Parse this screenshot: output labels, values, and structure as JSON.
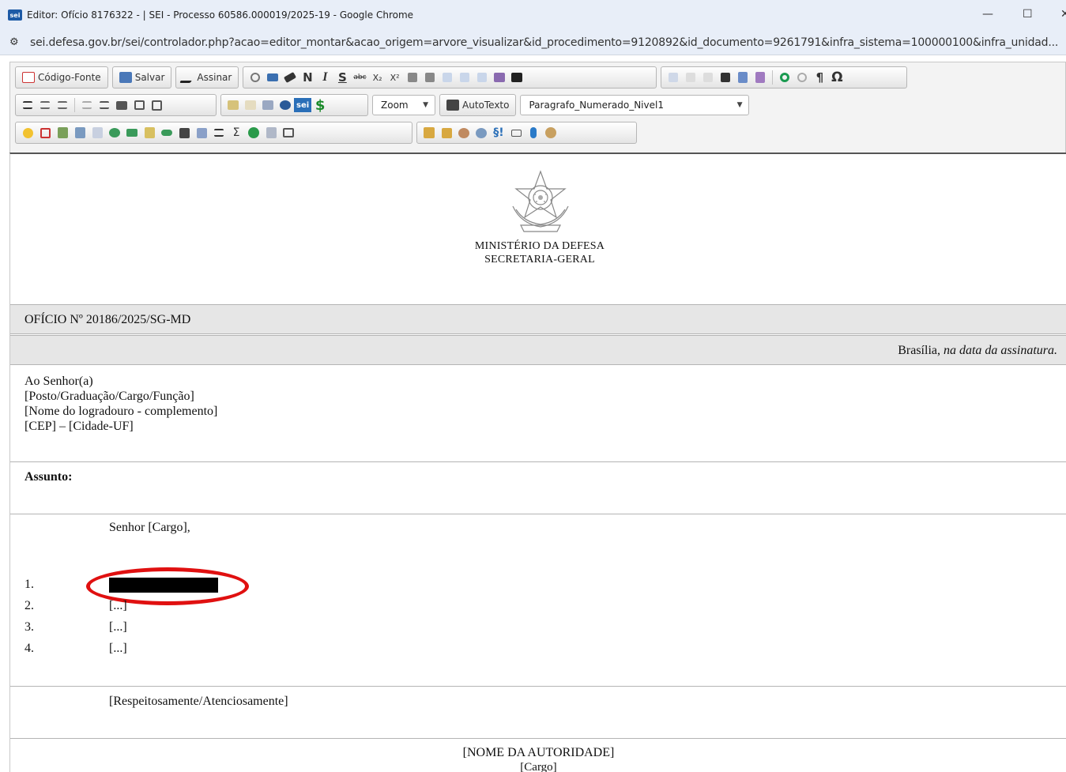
{
  "window": {
    "title": "Editor: Ofício 8176322 - | SEI - Processo 60586.000019/2025-19 - Google Chrome",
    "favicon_text": "sei",
    "minimize_glyph": "—",
    "maximize_glyph": "☐",
    "close_glyph": "✕"
  },
  "address_bar": {
    "url": "sei.defesa.gov.br/sei/controlador.php?acao=editor_montar&acao_origem=arvore_visualizar&id_procedimento=9120892&id_documento=9261791&infra_sistema=100000100&infra_unidad...",
    "site_icon_glyph": "⚙"
  },
  "toolbar": {
    "source_label": "Código-Fonte",
    "save_label": "Salvar",
    "sign_label": "Assinar",
    "bold_label": "N",
    "italic_label": "I",
    "strike_label": "S",
    "abc_label": "abc",
    "subscript_label": "X₂",
    "superscript_label": "X²",
    "omega_label": "Ω",
    "pilcrow_label": "¶",
    "zoom_label": "Zoom",
    "autotext_label": "AutoTexto",
    "style_value": "Paragrafo_Numerado_Nivel1",
    "sigma_label": "Σ",
    "section_label": "§!",
    "dollar_label": "$",
    "sei_label": "sei"
  },
  "colors": {
    "highlight_ring": "#e01010",
    "band_gray": "#e6e6e6",
    "chrome_bg": "#e8eef8"
  },
  "document": {
    "ministry": "MINISTÉRIO DA DEFESA",
    "secretariat": "SECRETARIA-GERAL",
    "oficio_number": "OFÍCIO Nº 20186/2025/SG-MD",
    "date_city": "Brasília,",
    "date_rest": "na data da assinatura.",
    "address": [
      "Ao Senhor(a)",
      "[Posto/Graduação/Cargo/Função]",
      "[Nome do logradouro - complemento]",
      "[CEP] – [Cidade-UF]"
    ],
    "subject_label": "Assunto:",
    "salutation": "Senhor [Cargo],",
    "items": [
      {
        "num": "1.",
        "text": ""
      },
      {
        "num": "2.",
        "text": "[...]"
      },
      {
        "num": "3.",
        "text": "[...]"
      },
      {
        "num": "4.",
        "text": "[...]"
      }
    ],
    "closing": "[Respeitosamente/Atenciosamente]",
    "authority_name": "[NOME DA AUTORIDADE]",
    "authority_role": "[Cargo]"
  }
}
